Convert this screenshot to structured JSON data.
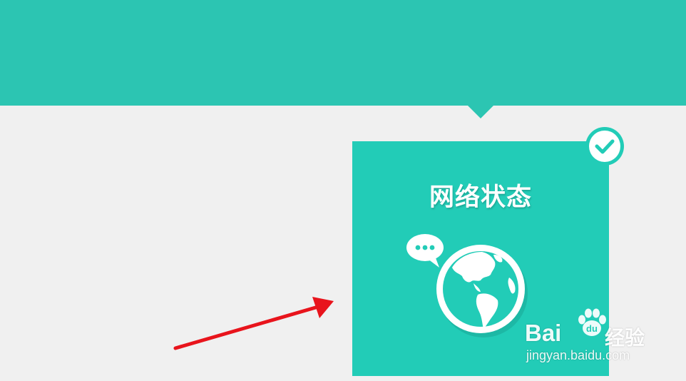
{
  "tile": {
    "title": "网络状态",
    "selected": true
  },
  "watermark": {
    "brand_prefix": "Bai",
    "brand_cn": "经验",
    "url": "jingyan.baidu.com"
  },
  "icons": {
    "tile_icon": "globe-with-chat-bubble-icon",
    "badge": "checkmark-circle-icon",
    "annotation": "red-arrow"
  },
  "colors": {
    "banner": "#2cc5b2",
    "tile": "#22ccb7",
    "background": "#f0f0f0",
    "arrow": "#e8141c",
    "foreground": "#ffffff"
  }
}
